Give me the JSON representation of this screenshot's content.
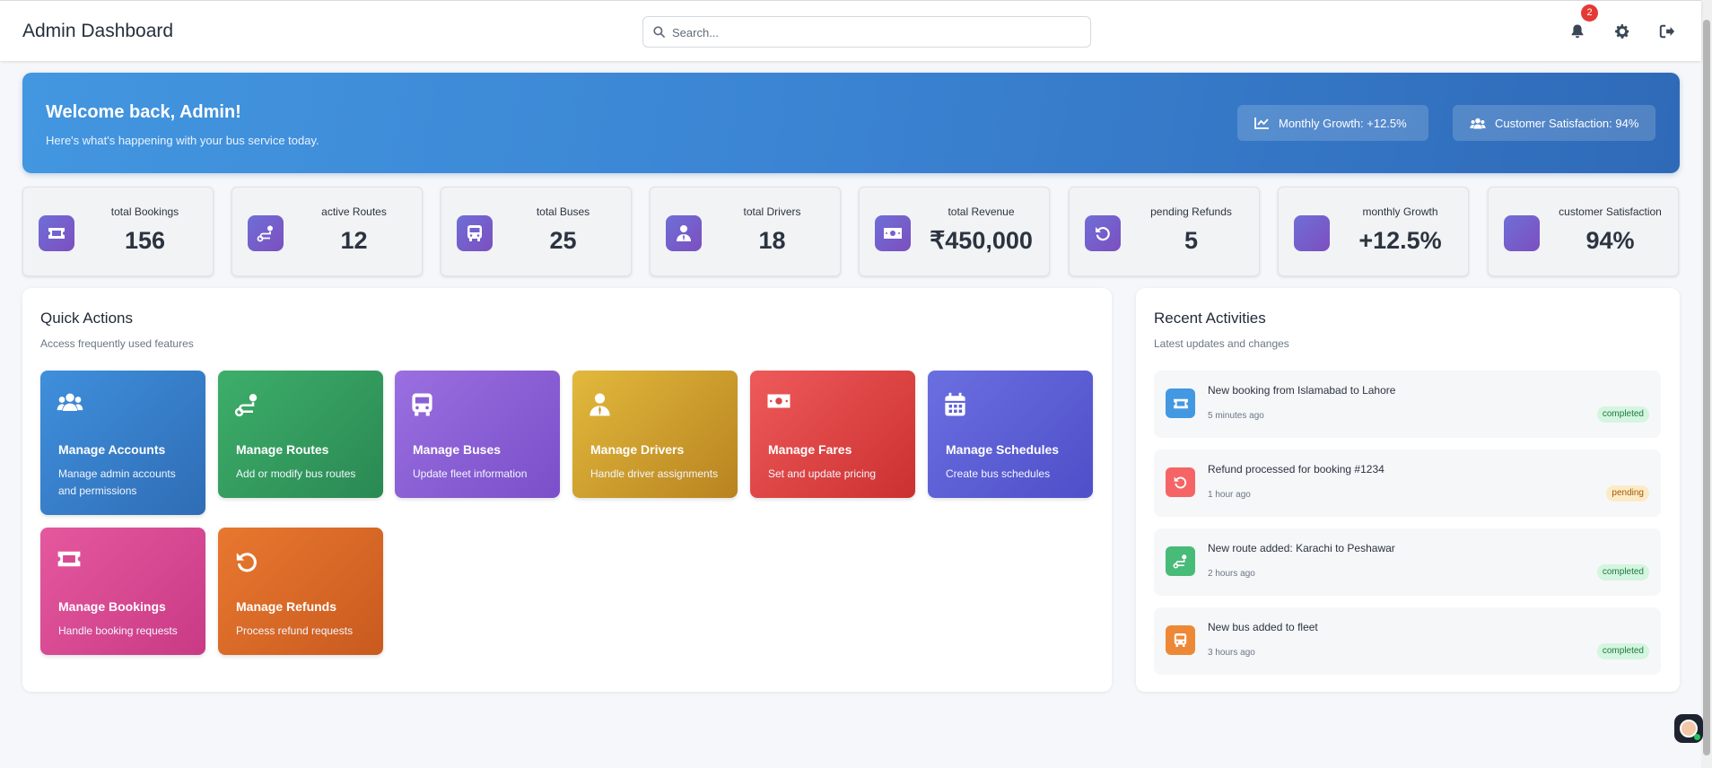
{
  "header": {
    "title": "Admin Dashboard",
    "search_placeholder": "Search...",
    "notification_count": "2",
    "icons": [
      "bell-icon",
      "gear-icon",
      "logout-icon"
    ]
  },
  "banner": {
    "title": "Welcome back, Admin!",
    "subtitle": "Here's what's happening with your bus service today.",
    "monthly_growth": "Monthly Growth: +12.5%",
    "satisfaction": "Customer Satisfaction: 94%"
  },
  "stats": [
    {
      "label": "total Bookings",
      "value": "156",
      "icon": "ticket-icon"
    },
    {
      "label": "active Routes",
      "value": "12",
      "icon": "route-icon"
    },
    {
      "label": "total Buses",
      "value": "25",
      "icon": "bus-icon"
    },
    {
      "label": "total Drivers",
      "value": "18",
      "icon": "driver-icon"
    },
    {
      "label": "total Revenue",
      "value": "₹450,000",
      "icon": "money-icon"
    },
    {
      "label": "pending Refunds",
      "value": "5",
      "icon": "refund-icon"
    },
    {
      "label": "monthly Growth",
      "value": "+12.5%",
      "icon": ""
    },
    {
      "label": "customer Satisfaction",
      "value": "94%",
      "icon": ""
    }
  ],
  "quick_actions": {
    "title": "Quick Actions",
    "subtitle": "Access frequently used features",
    "items": [
      {
        "title": "Manage Accounts",
        "desc": "Manage admin accounts and permissions",
        "icon": "users-icon",
        "colors": [
          "#3f8fdc",
          "#2f6db5"
        ]
      },
      {
        "title": "Manage Routes",
        "desc": "Add or modify bus routes",
        "icon": "route-icon",
        "colors": [
          "#3dae6a",
          "#2a8953"
        ]
      },
      {
        "title": "Manage Buses",
        "desc": "Update fleet information",
        "icon": "bus-icon",
        "colors": [
          "#9a6fe0",
          "#7a4fc9"
        ]
      },
      {
        "title": "Manage Drivers",
        "desc": "Handle driver assignments",
        "icon": "driver-icon",
        "colors": [
          "#e2b93c",
          "#b88320"
        ]
      },
      {
        "title": "Manage Fares",
        "desc": "Set and update pricing",
        "icon": "money-icon",
        "colors": [
          "#ee5a5a",
          "#cc3030"
        ]
      },
      {
        "title": "Manage Schedules",
        "desc": "Create bus schedules",
        "icon": "calendar-icon",
        "colors": [
          "#6a6fe0",
          "#4f4fc9"
        ]
      },
      {
        "title": "Manage Bookings",
        "desc": "Handle booking requests",
        "icon": "ticket-icon",
        "colors": [
          "#e5589e",
          "#c93a85"
        ]
      },
      {
        "title": "Manage Refunds",
        "desc": "Process refund requests",
        "icon": "refund-icon",
        "colors": [
          "#e8782f",
          "#c95a1f"
        ]
      }
    ]
  },
  "recent_activities": {
    "title": "Recent Activities",
    "subtitle": "Latest updates and changes",
    "items": [
      {
        "text": "New booking from Islamabad to Lahore",
        "time": "5 minutes ago",
        "status": "completed",
        "icon": "ticket-icon",
        "color": "#4299e1"
      },
      {
        "text": "Refund processed for booking #1234",
        "time": "1 hour ago",
        "status": "pending",
        "icon": "refund-icon",
        "color": "#f56565"
      },
      {
        "text": "New route added: Karachi to Peshawar",
        "time": "2 hours ago",
        "status": "completed",
        "icon": "route-icon",
        "color": "#48bb78"
      },
      {
        "text": "New bus added to fleet",
        "time": "3 hours ago",
        "status": "completed",
        "icon": "bus-icon",
        "color": "#ed8936"
      }
    ]
  }
}
